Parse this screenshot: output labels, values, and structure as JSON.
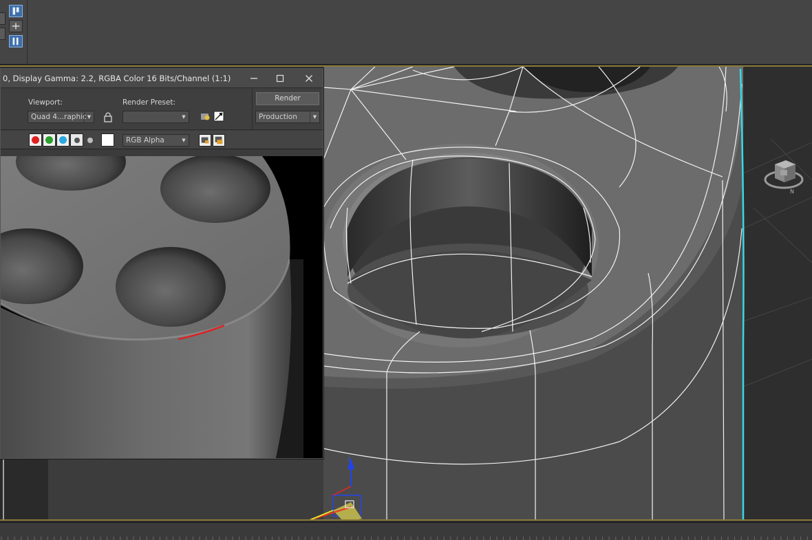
{
  "render_window": {
    "title": "0, Display Gamma: 2.2, RGBA Color 16 Bits/Channel (1:1)",
    "viewport_label": "Viewport:",
    "viewport_value": "Quad 4...raphic",
    "render_preset_label": "Render Preset:",
    "render_preset_value": "",
    "render_button": "Render",
    "production_value": "Production",
    "channel_display": "RGB Alpha",
    "channels": [
      {
        "name": "red",
        "color": "#e02020"
      },
      {
        "name": "green",
        "color": "#2ca02c"
      },
      {
        "name": "blue",
        "color": "#29a9e0"
      }
    ]
  },
  "colors": {
    "viewport_border": "#8a7a3a",
    "selection_cyan": "#38d8e8",
    "toolbar_active": "#3e6ea8",
    "error_line": "#e02020"
  },
  "icons": [
    "minimize-icon",
    "maximize-icon",
    "close-icon",
    "lock-icon",
    "save-image-icon",
    "clone-frame-icon",
    "nav-cube-icon",
    "transform-gizmo-icon"
  ]
}
